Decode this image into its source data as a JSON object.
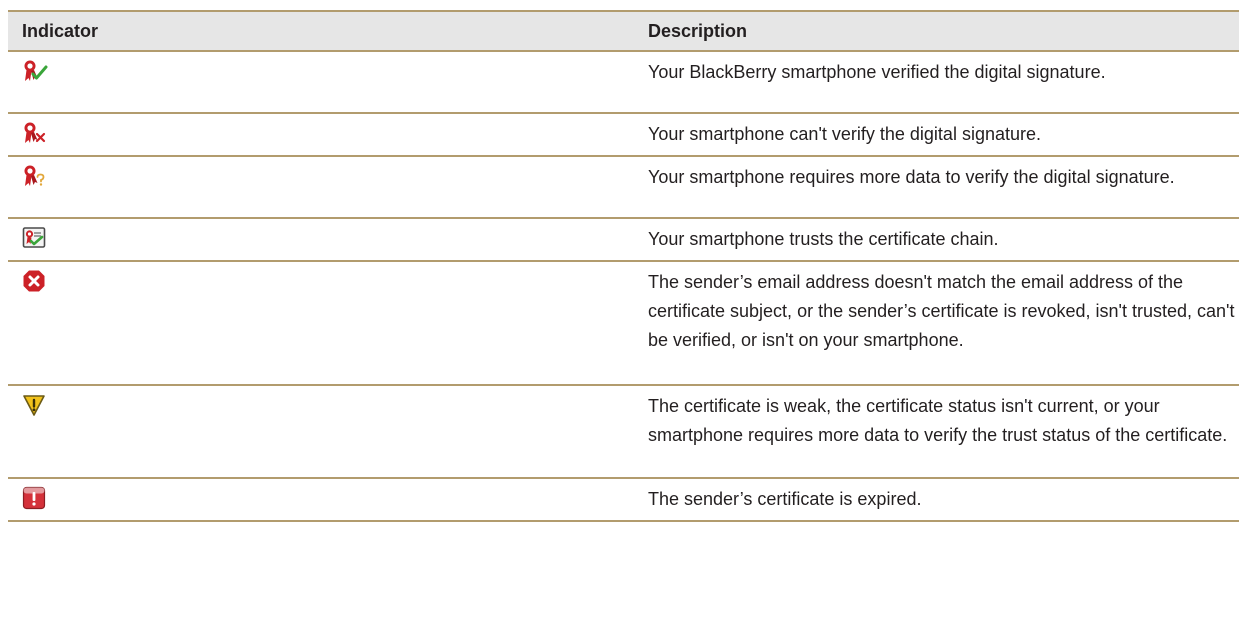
{
  "table": {
    "headers": {
      "indicator": "Indicator",
      "description": "Description"
    },
    "rows": [
      {
        "icon": "signature-verified-icon",
        "description": "Your BlackBerry smartphone verified the digital signature."
      },
      {
        "icon": "signature-not-verified-icon",
        "description": "Your smartphone can't verify the digital signature."
      },
      {
        "icon": "signature-needs-data-icon",
        "description": "Your smartphone requires more data to verify the digital signature."
      },
      {
        "icon": "certificate-chain-trusted-icon",
        "description": "Your smartphone trusts the certificate chain."
      },
      {
        "icon": "error-x-icon",
        "description": "The sender’s email address doesn't match the email address of the certificate subject, or the sender’s certificate is revoked, isn't trusted, can't be verified, or isn't on your smartphone."
      },
      {
        "icon": "warning-triangle-icon",
        "description": "The certificate is weak, the certificate status isn't current, or your smartphone requires more data to verify the trust status of the certificate."
      },
      {
        "icon": "certificate-expired-icon",
        "description": "The sender’s certificate is expired."
      }
    ]
  },
  "colors": {
    "rule": "#b29c6e",
    "header_bg": "#e6e6e6",
    "ribbon_red": "#cc2127",
    "check_green": "#3aa53a",
    "warning_yellow": "#f2c21b"
  }
}
